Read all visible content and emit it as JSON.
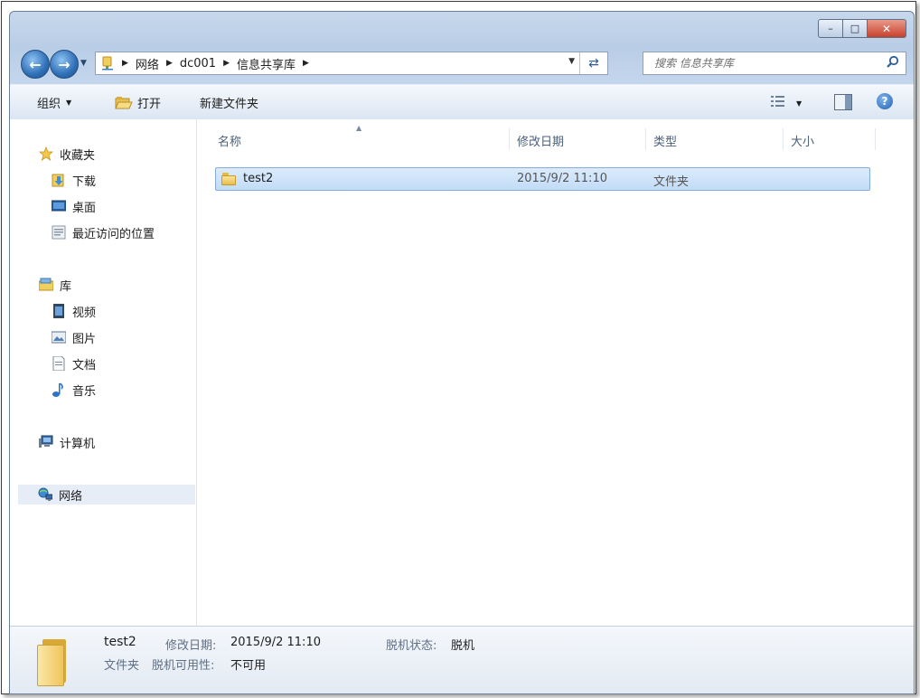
{
  "address": {
    "crumbs": [
      "网络",
      "dc001",
      "信息共享库"
    ]
  },
  "search": {
    "placeholder": "搜索 信息共享库"
  },
  "toolbar": {
    "organize": "组织",
    "open": "打开",
    "new_folder": "新建文件夹"
  },
  "nav_pane": {
    "favorites": {
      "label": "收藏夹",
      "items": [
        "下载",
        "桌面",
        "最近访问的位置"
      ]
    },
    "libraries": {
      "label": "库",
      "items": [
        "视频",
        "图片",
        "文档",
        "音乐"
      ]
    },
    "computer": "计算机",
    "network": "网络"
  },
  "columns": {
    "name": "名称",
    "modified": "修改日期",
    "type": "类型",
    "size": "大小"
  },
  "files": [
    {
      "name": "test2",
      "modified": "2015/9/2 11:10",
      "type": "文件夹",
      "size": ""
    }
  ],
  "details": {
    "name": "test2",
    "type": "文件夹",
    "modified_label": "修改日期:",
    "modified_value": "2015/9/2 11:10",
    "offline_status_label": "脱机状态:",
    "offline_status_value": "脱机",
    "offline_availability_label": "脱机可用性:",
    "offline_availability_value": "不可用"
  },
  "colors": {
    "selection": "#c1dcf7",
    "selection_border": "#84acdd",
    "chrome": "#c4d6ec"
  }
}
